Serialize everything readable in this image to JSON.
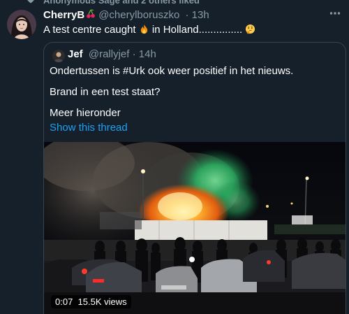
{
  "liked_bar": {
    "text": "Anonymous Sage and 2 others liked"
  },
  "tweet": {
    "display_name": "CherryB",
    "handle": "@cherylboruszko",
    "separator": "·",
    "time": "13h",
    "text_before": "A test centre caught ",
    "text_after": " in Holland............... ",
    "icons": [
      "cherry-icon",
      "fire-emoji-icon",
      "thinking-emoji-icon",
      "more-options-icon",
      "heart-icon"
    ]
  },
  "quoted": {
    "display_name": "Jef",
    "handle": "@rallyjef",
    "separator": "·",
    "time": "14h",
    "lines": [
      "Ondertussen is #Urk ook weer positief in het nieuws.",
      "Brand in een test staat?",
      "Meer hieronder"
    ],
    "show_thread": "Show this thread",
    "video": {
      "duration": "0:07",
      "views": "15.5K views"
    }
  },
  "colors": {
    "background": "#15202b",
    "border": "#38444d",
    "secondary_text": "#8899a6",
    "link": "#1da1f2"
  }
}
